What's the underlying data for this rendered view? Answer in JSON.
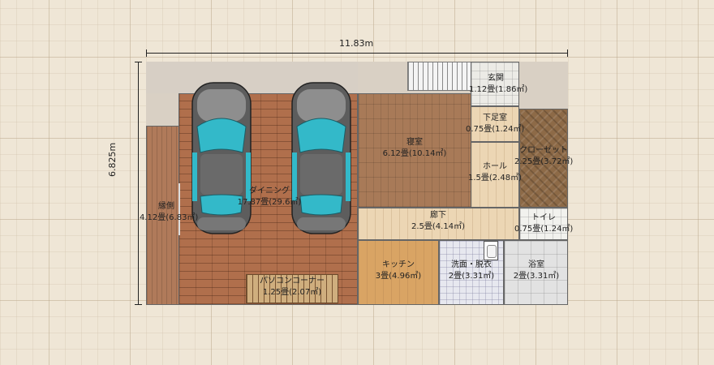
{
  "plan": {
    "dimensions": {
      "width": "11.83m",
      "depth": "6.825m"
    },
    "rooms": {
      "entrance": {
        "name": "玄関",
        "area": "1.12畳(1.86㎡)"
      },
      "shoe_room": {
        "name": "下足室",
        "area": "0.75畳(1.24㎡)"
      },
      "bedroom": {
        "name": "寝室",
        "area": "6.12畳(10.14㎡)"
      },
      "hall": {
        "name": "ホール",
        "area": "1.5畳(2.48㎡)"
      },
      "closet": {
        "name": "クローゼット",
        "area": "2.25畳(3.72㎡)"
      },
      "dining": {
        "name": "ダイニング",
        "area": "17.87畳(29.6㎡)"
      },
      "veranda": {
        "name": "縁側",
        "area": "4.12畳(6.83㎡)"
      },
      "corridor": {
        "name": "廊下",
        "area": "2.5畳(4.14㎡)"
      },
      "toilet": {
        "name": "トイレ",
        "area": "0.75畳(1.24㎡)"
      },
      "kitchen": {
        "name": "キッチン",
        "area": "3畳(4.96㎡)"
      },
      "washroom": {
        "name": "洗面・脱衣",
        "area": "2畳(3.31㎡)"
      },
      "bathroom": {
        "name": "浴室",
        "area": "2畳(3.31㎡)"
      },
      "pc_corner": {
        "name": "パソコンコーナー",
        "area": "1.25畳(2.07㎡)"
      }
    },
    "colors": {
      "car_body": "#5d5d5d",
      "car_glass": "#33b9c9",
      "walls": "#666666"
    },
    "icons": [
      "car-top-view-icon",
      "car-top-view-icon",
      "sink-icon"
    ]
  }
}
